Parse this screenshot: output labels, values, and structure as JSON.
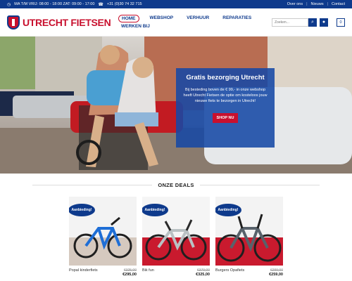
{
  "topbar": {
    "hours": "MA T/M VRIJ: 08:00 - 18:00 ZAT: 09:00 - 17:00",
    "phone": "+31 (0)30 74 32 715",
    "links": [
      "Over ons",
      "Nieuws",
      "Contact"
    ]
  },
  "brand": {
    "name": "UTRECHT FIETSEN"
  },
  "nav": [
    "HOME",
    "WEBSHOP",
    "VERHUUR",
    "REPARATIES",
    "WERKEN BIJ"
  ],
  "search": {
    "placeholder": "Zoeken..."
  },
  "cart": {
    "count": "0"
  },
  "hero": {
    "title": "Gratis bezorging Utrecht",
    "text": "Bij besteding boven de € 99,- in onze webshop heeft Utrecht Fietsen de optie om kosteloos jouw nieuwe fiets te bezorgen in Utrecht!",
    "button": "SHOP NU"
  },
  "deals_title": "ONZE DEALS",
  "products": [
    {
      "badge": "Aanbieding!",
      "name": "Popal kinderfiets",
      "old": "€325,00",
      "new": "€295,00",
      "frame": "#1e6ed6"
    },
    {
      "badge": "Aanbieding!",
      "name": "Bik fun",
      "old": "€379,00",
      "new": "€325,00",
      "frame": "#b9c1c3"
    },
    {
      "badge": "Aanbieding!",
      "name": "Burgers Opafiets",
      "old": "€299,00",
      "new": "€259,00",
      "frame": "#58626b"
    }
  ],
  "colors": {
    "primary": "#0e3a8c",
    "accent": "#c8102e"
  }
}
